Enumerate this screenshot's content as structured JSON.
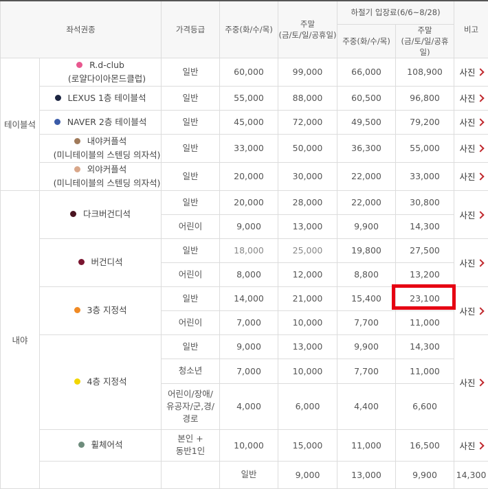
{
  "header": {
    "seat_type": "좌석권종",
    "price_grade": "가격등급",
    "weekday": "주중(화/수/목)",
    "weekend_line1": "주말",
    "weekend_line2": "(금/토/일/공휴일)",
    "summer": "하절기 입장료(6/6~8/28)",
    "summer_weekday": "주중(화/수/목)",
    "summer_weekend_line1": "주말",
    "summer_weekend_line2": "(금/토/일/공휴일)",
    "note": "비고"
  },
  "zones": {
    "table": "테이블석",
    "infield": "내야"
  },
  "photo_label": "사진",
  "seats": [
    {
      "line1": "R.d-club",
      "line2": "(로얄다이아몬드클럽)",
      "color": "#e8588f",
      "grade": "일반",
      "wd": "60,000",
      "we": "99,000",
      "swd": "66,000",
      "swe": "108,900"
    },
    {
      "line1": "LEXUS 1층 테이블석",
      "color": "#1c2541",
      "grade": "일반",
      "wd": "55,000",
      "we": "88,000",
      "swd": "60,500",
      "swe": "96,800"
    },
    {
      "line1": "NAVER 2층 테이블석",
      "color": "#3a5ba8",
      "grade": "일반",
      "wd": "45,000",
      "we": "72,000",
      "swd": "49,500",
      "swe": "79,200"
    },
    {
      "line1": "내야커플석",
      "line2": "(미니테이블의 스텐딩 의자석)",
      "color": "#a07a5a",
      "grade": "일반",
      "wd": "33,000",
      "we": "50,000",
      "swd": "36,300",
      "swe": "55,000"
    },
    {
      "line1": "외야커플석",
      "line2": "(미니테이블의 스텐딩 의자석)",
      "color": "#d9a78a",
      "grade": "일반",
      "wd": "20,000",
      "we": "30,000",
      "swd": "22,000",
      "swe": "33,000"
    },
    {
      "line1": "다크버건디석",
      "color": "#4a1420",
      "rows": [
        {
          "grade": "일반",
          "wd": "20,000",
          "we": "28,000",
          "swd": "22,000",
          "swe": "30,800"
        },
        {
          "grade": "어린이",
          "wd": "9,000",
          "we": "13,000",
          "swd": "9,900",
          "swe": "14,300"
        }
      ]
    },
    {
      "line1": "버건디석",
      "color": "#7a1630",
      "rows": [
        {
          "grade": "일반",
          "wd": "18,000",
          "we": "25,000",
          "swd": "19,800",
          "swe": "27,500"
        },
        {
          "grade": "어린이",
          "wd": "8,000",
          "we": "12,000",
          "swd": "8,800",
          "swe": "13,200"
        }
      ]
    },
    {
      "line1": "3층 지정석",
      "color": "#f08a24",
      "rows": [
        {
          "grade": "일반",
          "wd": "14,000",
          "we": "21,000",
          "swd": "15,400",
          "swe": "23,100"
        },
        {
          "grade": "어린이",
          "wd": "7,000",
          "we": "10,000",
          "swd": "7,700",
          "swe": "11,000"
        }
      ]
    },
    {
      "line1": "4층 지정석",
      "color": "#f2d600",
      "rows": [
        {
          "grade": "일반",
          "wd": "9,000",
          "we": "13,000",
          "swd": "9,900",
          "swe": "14,300"
        },
        {
          "grade": "청소년",
          "wd": "7,000",
          "we": "10,000",
          "swd": "7,700",
          "swe": "11,000"
        },
        {
          "grade_lines": [
            "어린이/장애/",
            "유공자/군,경/",
            "경로"
          ],
          "wd": "4,000",
          "we": "6,000",
          "swd": "4,400",
          "swe": "6,600"
        }
      ]
    },
    {
      "line1": "휠체어석",
      "color": "#6e8c7c",
      "grade_lines": [
        "본인 +",
        "동반1인"
      ],
      "wd": "10,000",
      "we": "15,000",
      "swd": "11,000",
      "swe": "16,500"
    }
  ],
  "last_row": {
    "grade": "일반",
    "wd": "9,000",
    "we": "13,000",
    "swd": "9,900",
    "swe": "14,300"
  },
  "highlight_color": "#e60012"
}
